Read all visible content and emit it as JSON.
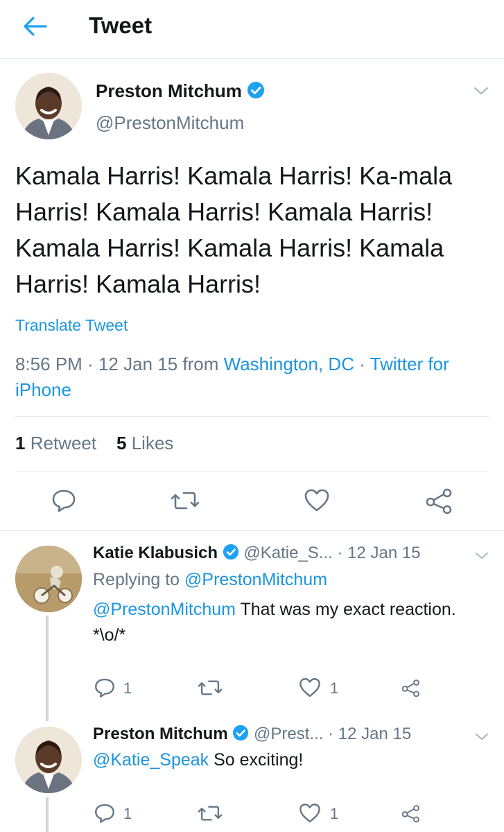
{
  "header": {
    "title": "Tweet"
  },
  "main_tweet": {
    "name": "Preston Mitchum",
    "handle": "@PrestonMitchum",
    "text": "Kamala Harris! Kamala Harris! Ka-mala Harris! Kamala Harris! Kamala Harris! Kamala Harris! Kamala Harris! Kamala Harris! Kamala Harris!",
    "translate": "Translate Tweet",
    "time": "8:56 PM",
    "date": "12 Jan 15",
    "from": "from",
    "location": "Washington, DC",
    "client": "Twitter for iPhone",
    "retweet_count": "1",
    "retweet_label": "Retweet",
    "like_count": "5",
    "like_label": "Likes"
  },
  "replies": [
    {
      "name": "Katie Klabusich",
      "handle": "@Katie_S...",
      "date": "12 Jan 15",
      "replying_label": "Replying to",
      "replying_to": "@PrestonMitchum",
      "mention": "@PrestonMitchum",
      "text": " That was my exact reaction. *\\o/*",
      "reply_count": "1",
      "like_count": "1"
    },
    {
      "name": "Preston Mitchum",
      "handle": "@Prest...",
      "date": "12 Jan 15",
      "mention": "@Katie_Speak",
      "text": " So exciting!",
      "reply_count": "1",
      "like_count": "1"
    }
  ],
  "colors": {
    "accent": "#1da1f2",
    "link": "#1b95e0",
    "muted": "#657786",
    "divider": "#e1e8ed"
  }
}
